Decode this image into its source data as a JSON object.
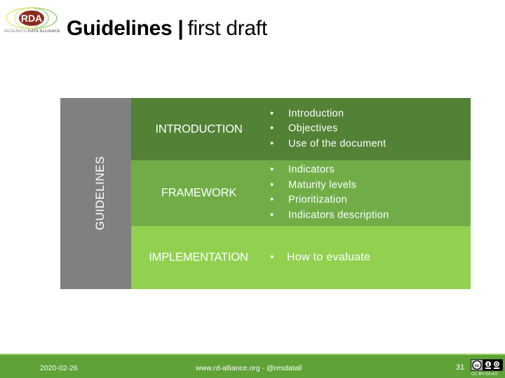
{
  "logo": {
    "acronym": "RDA",
    "caption_regular": "RESEARCH",
    "caption_bold": "DATA ALLIANCE"
  },
  "header": {
    "title_bold": "Guidelines",
    "separator": "|",
    "title_light": "first draft"
  },
  "diagram": {
    "side_label": "GUIDELINES",
    "colors": {
      "side": "#808080",
      "introduction": "#538135",
      "framework": "#70ad47",
      "implementation": "#92d050"
    },
    "sections": [
      {
        "title": "INTRODUCTION",
        "items": [
          "Introduction",
          "Objectives",
          "Use of the document"
        ]
      },
      {
        "title": "FRAMEWORK",
        "items": [
          "Indicators",
          "Maturity levels",
          "Prioritization",
          "Indicators description"
        ]
      },
      {
        "title": "IMPLEMENTATION",
        "items": [
          "How to evaluate"
        ]
      }
    ]
  },
  "footer": {
    "date": "2020-02-26",
    "url": "www.rd-alliance.org - @resdatall",
    "page_number": "31",
    "license": "CC BY-SA 4.0",
    "color": "#5fa236"
  }
}
